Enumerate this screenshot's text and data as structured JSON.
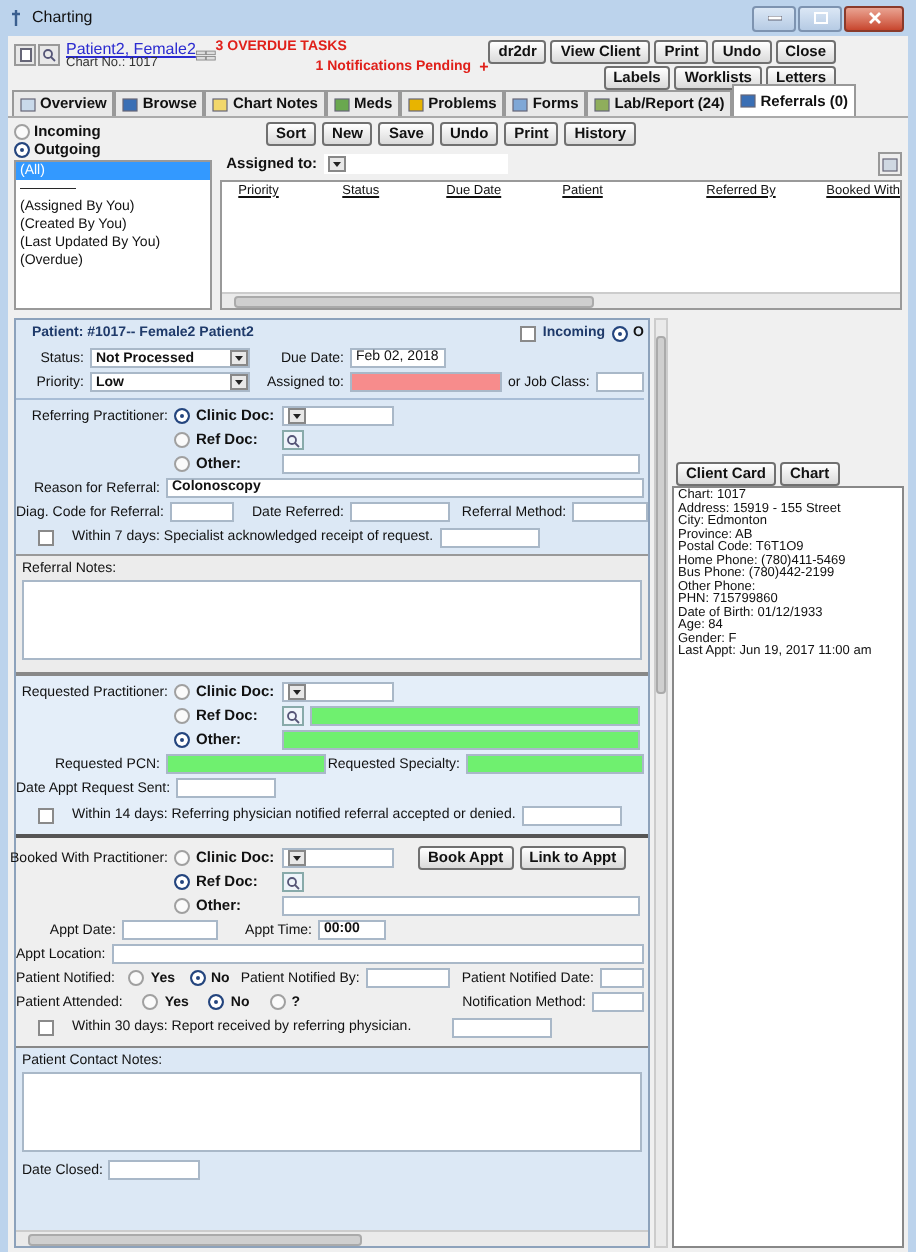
{
  "window": {
    "title": "Charting"
  },
  "header": {
    "patient_name": "Patient2, Female2",
    "chart_no": "Chart No.: 1017",
    "overdue_tasks": "3 OVERDUE TASKS",
    "notifications": "1 Notifications Pending",
    "notification_mark": "+",
    "buttons": [
      {
        "label": "dr2dr"
      },
      {
        "label": "View Client"
      },
      {
        "label": "Print"
      },
      {
        "label": "Undo"
      },
      {
        "label": "Close"
      }
    ],
    "buttons_row2": [
      {
        "label": "Labels"
      },
      {
        "label": "Worklists"
      },
      {
        "label": "Letters"
      }
    ]
  },
  "tabs": [
    {
      "label": "Overview",
      "selected": false
    },
    {
      "label": "Browse",
      "selected": false
    },
    {
      "label": "Chart Notes",
      "selected": false
    },
    {
      "label": "Meds",
      "selected": false
    },
    {
      "label": "Problems",
      "selected": false
    },
    {
      "label": "Forms",
      "selected": false
    },
    {
      "label": "Lab/Report (24)",
      "selected": false
    },
    {
      "label": "Referrals (0)",
      "selected": true
    }
  ],
  "direction": [
    {
      "label": "Incoming",
      "selected": false
    },
    {
      "label": "Outgoing",
      "selected": true
    }
  ],
  "filters": [
    {
      "label": "(All)",
      "selected": true
    },
    {
      "label": "————",
      "selected": false
    },
    {
      "label": "(Assigned By You)",
      "selected": false
    },
    {
      "label": "(Created By You)",
      "selected": false
    },
    {
      "label": "(Last Updated By You)",
      "selected": false
    },
    {
      "label": "(Overdue)",
      "selected": false
    }
  ],
  "toolbar": [
    {
      "label": "Sort"
    },
    {
      "label": "New"
    },
    {
      "label": "Save"
    },
    {
      "label": "Undo"
    },
    {
      "label": "Print"
    },
    {
      "label": "History"
    }
  ],
  "assigned_filter": {
    "label": "Assigned to:"
  },
  "table": {
    "columns": [
      "Priority",
      "Status",
      "Due Date",
      "Patient",
      "Referred By",
      "Booked With"
    ]
  },
  "referral": {
    "patient": "Patient: #1017-- Female2 Patient2",
    "incoming": {
      "label": "Incoming",
      "checked": false
    },
    "outgoing": {
      "label": "O",
      "selected": true
    },
    "status": {
      "label": "Status:",
      "value": "Not Processed"
    },
    "due_date": {
      "label": "Due Date:",
      "value": "Feb 02, 2018"
    },
    "priority": {
      "label": "Priority:",
      "value": "Low"
    },
    "assigned_to": {
      "label": "Assigned to:",
      "error": true
    },
    "job_class": {
      "label": "or Job Class:"
    },
    "referring": {
      "label": "Referring Practitioner:",
      "options": [
        {
          "label": "Clinic Doc:",
          "selected": true,
          "kind": "select"
        },
        {
          "label": "Ref Doc:",
          "selected": false,
          "kind": "search"
        },
        {
          "label": "Other:",
          "selected": false,
          "kind": "text"
        }
      ]
    },
    "reason": {
      "label": "Reason for Referral:",
      "value": "Colonoscopy"
    },
    "diag_code": {
      "label": "Diag. Code for Referral:"
    },
    "date_referred": {
      "label": "Date Referred:"
    },
    "referral_method": {
      "label": "Referral Method:"
    },
    "ack_7": {
      "label": "Within 7 days: Specialist acknowledged receipt of request.",
      "checked": false
    },
    "referral_notes": {
      "label": "Referral Notes:"
    },
    "requested": {
      "label": "Requested Practitioner:",
      "options": [
        {
          "label": "Clinic Doc:",
          "selected": false,
          "kind": "select"
        },
        {
          "label": "Ref Doc:",
          "selected": false,
          "kind": "search",
          "field": {
            "highlighted": true
          }
        },
        {
          "label": "Other:",
          "selected": true,
          "kind": "text",
          "field": {
            "highlighted": true
          }
        }
      ]
    },
    "requested_pcn": {
      "label": "Requested PCN:",
      "highlighted": true
    },
    "requested_specialty": {
      "label": "Requested Specialty:",
      "highlighted": true
    },
    "date_request_sent": {
      "label": "Date Appt Request Sent:"
    },
    "ack_14": {
      "label": "Within 14 days: Referring physician notified referral accepted or denied.",
      "checked": false
    },
    "booked": {
      "label": "Booked With Practitioner:",
      "buttons": [
        {
          "label": "Book Appt"
        },
        {
          "label": "Link to Appt"
        }
      ],
      "options": [
        {
          "label": "Clinic Doc:",
          "selected": false,
          "kind": "select"
        },
        {
          "label": "Ref Doc:",
          "selected": true,
          "kind": "search"
        },
        {
          "label": "Other:",
          "selected": false,
          "kind": "text"
        }
      ]
    },
    "appt_date": {
      "label": "Appt Date:"
    },
    "appt_time": {
      "label": "Appt Time:",
      "value": "00:00"
    },
    "appt_location": {
      "label": "Appt Location:"
    },
    "patient_notified": {
      "label": "Patient Notified:",
      "options": [
        {
          "label": "Yes",
          "selected": false
        },
        {
          "label": "No",
          "selected": true
        }
      ]
    },
    "notified_by": {
      "label": "Patient Notified By:"
    },
    "notified_date": {
      "label": "Patient Notified Date:"
    },
    "patient_attended": {
      "label": "Patient Attended:",
      "options": [
        {
          "label": "Yes",
          "selected": false
        },
        {
          "label": "No",
          "selected": true
        },
        {
          "label": "?",
          "selected": false
        }
      ]
    },
    "notification_method": {
      "label": "Notification Method:"
    },
    "ack_30": {
      "label": "Within 30 days: Report received by referring physician.",
      "checked": false
    },
    "contact_notes": {
      "label": "Patient Contact Notes:"
    },
    "date_closed": {
      "label": "Date Closed:"
    }
  },
  "client_card": {
    "buttons": [
      {
        "label": "Client Card"
      },
      {
        "label": "Chart"
      }
    ],
    "lines": [
      "Chart: 1017",
      "Address: 15919 - 155 Street",
      "City: Edmonton",
      "Province: AB",
      "Postal Code: T6T1O9",
      "Home Phone: (780)411-5469",
      "Bus Phone: (780)442-2199",
      "Other Phone:",
      "PHN: 715799860",
      "Date of Birth: 01/12/1933",
      "Age: 84",
      "Gender: F",
      "Last Appt: Jun 19, 2017 11:00 am"
    ]
  }
}
